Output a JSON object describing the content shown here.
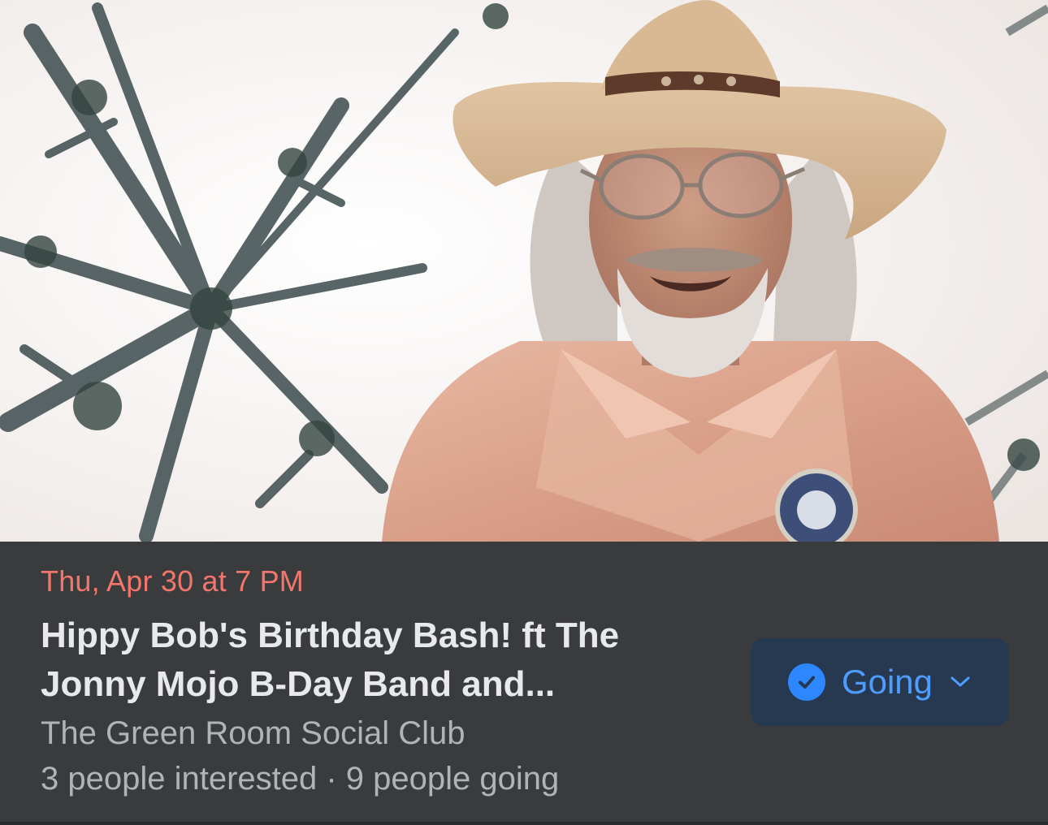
{
  "event": {
    "date": "Thu, Apr 30 at 7 PM",
    "title_line1": "Hippy Bob's Birthday Bash! ft The",
    "title_line2": "Jonny Mojo B-Day Band and...",
    "venue": "The Green Room Social Club",
    "stats": "3 people interested · 9 people going"
  },
  "rsvp": {
    "label": "Going",
    "icon": "check-circle-icon",
    "dropdown_icon": "chevron-down-icon"
  },
  "colors": {
    "date": "#f2766c",
    "accent": "#2d88ff",
    "button_bg": "#263951",
    "panel_bg": "#3a3b3c"
  }
}
